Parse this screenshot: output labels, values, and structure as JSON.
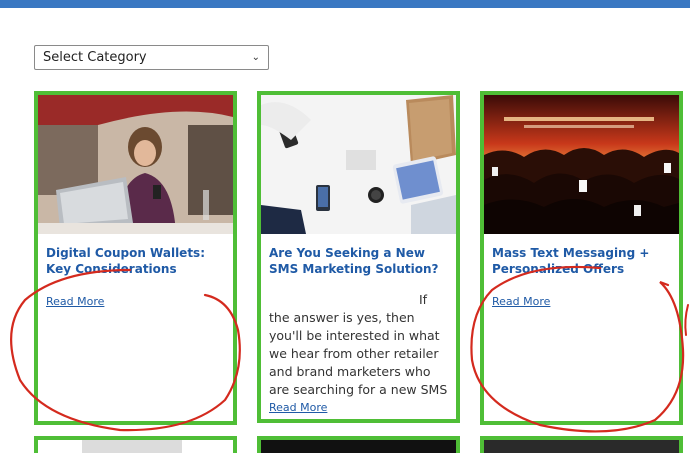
{
  "filter": {
    "selected": "Select Category"
  },
  "cards": [
    {
      "title": "Digital Coupon Wallets: Key Considerations",
      "excerpt": "",
      "read_more": "Read More"
    },
    {
      "title": "Are You Seeking a New SMS Marketing Solution?",
      "excerpt": "If the answer is yes, then you'll be interested in what we hear from other retailer and brand marketers who are searching for a new SMS",
      "read_more": "Read More"
    },
    {
      "title": "Mass Text Messaging + Personalized Offers",
      "excerpt": "",
      "read_more": "Read More"
    }
  ],
  "colors": {
    "card_border": "#4fbe36",
    "link": "#1f5aa6",
    "annotation": "#d42a1e",
    "top_bar": "#3a78c2"
  },
  "icons": {
    "select_chevron": "chevron-down-icon"
  }
}
